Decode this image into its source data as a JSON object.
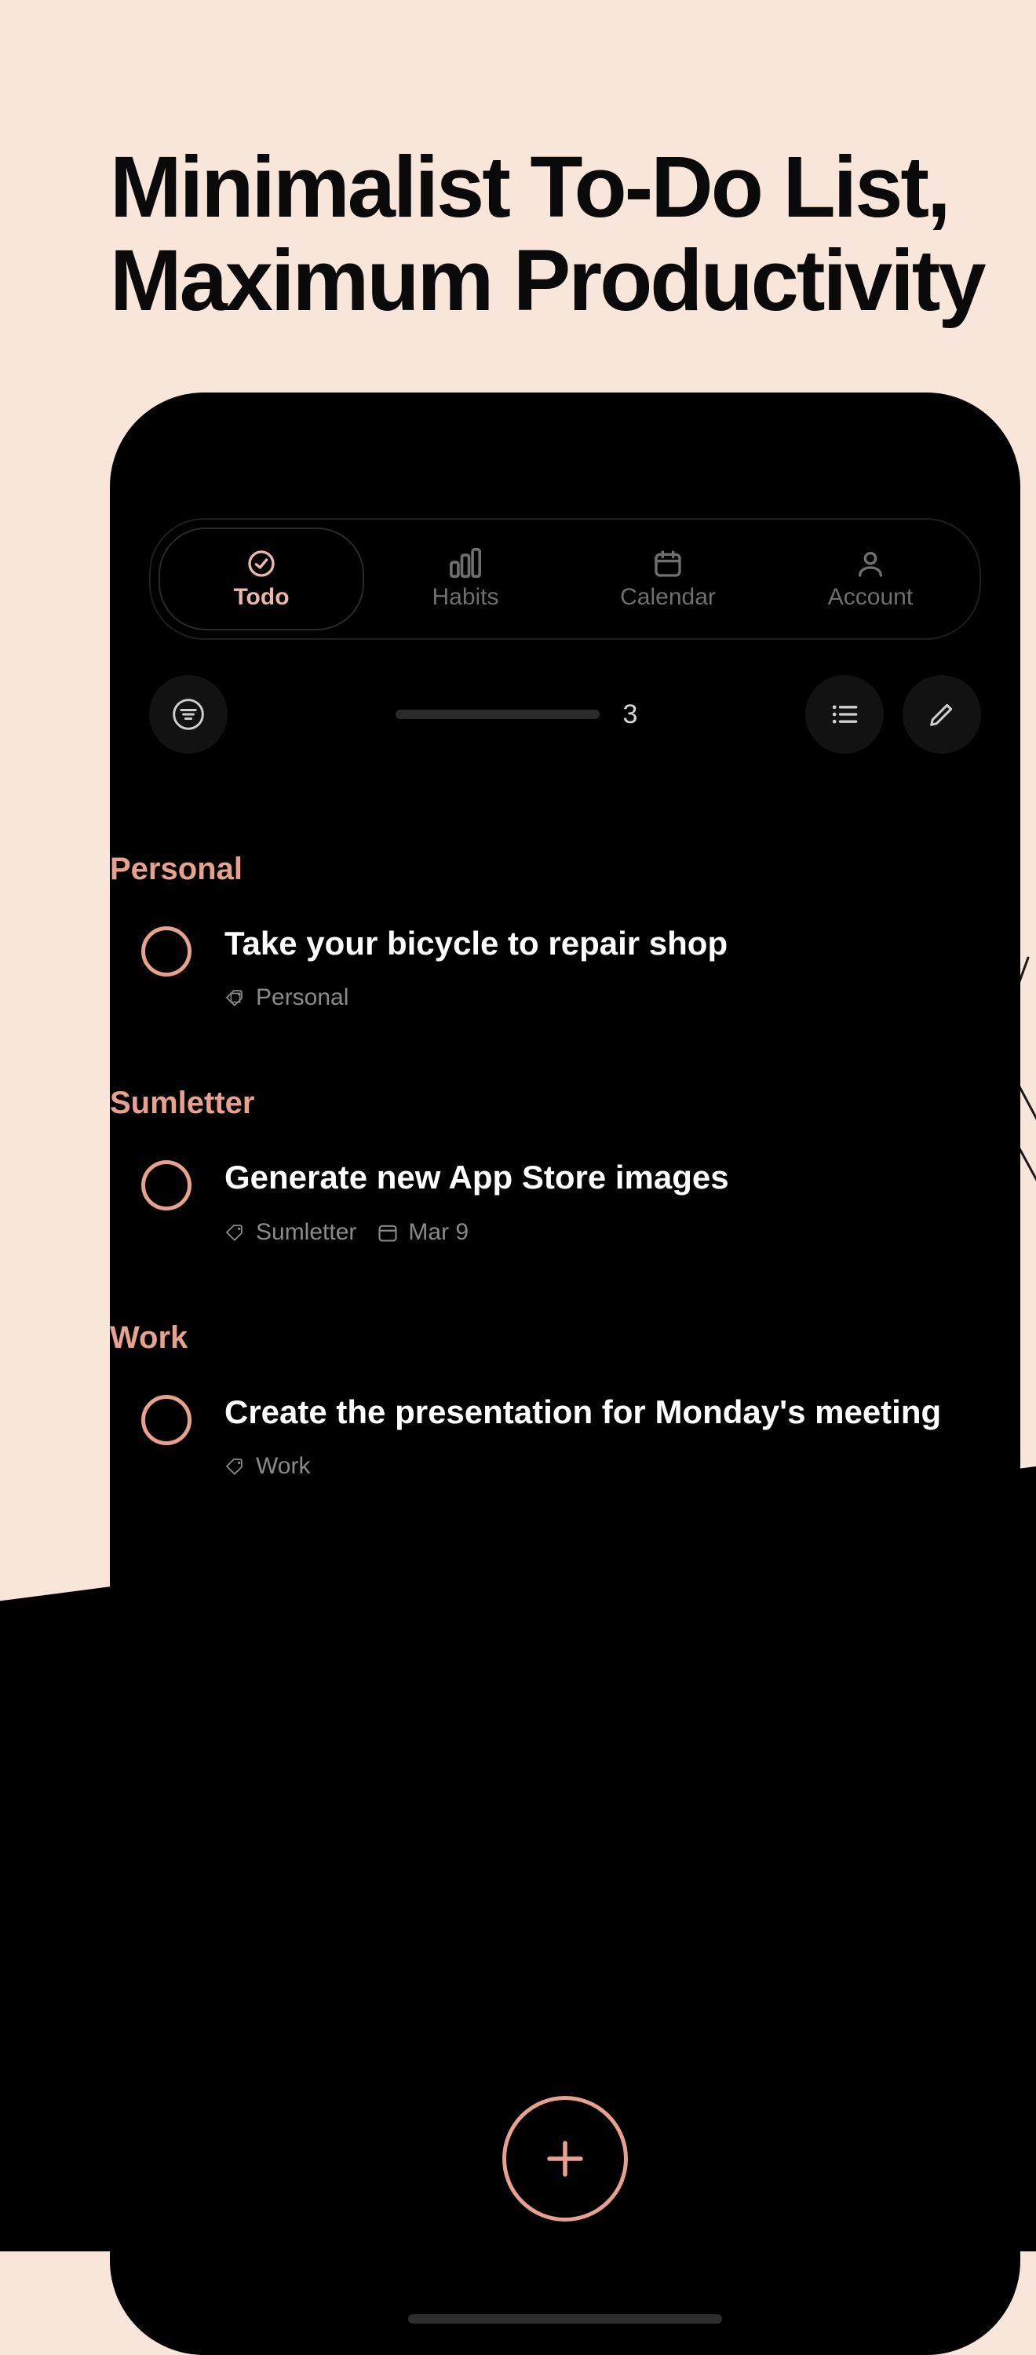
{
  "headline": {
    "line1": "Minimalist To-Do List,",
    "line2": "Maximum Productivity"
  },
  "nav": {
    "tabs": [
      {
        "label": "Todo",
        "icon": "check-circle-icon",
        "active": true
      },
      {
        "label": "Habits",
        "icon": "bar-chart-icon",
        "active": false
      },
      {
        "label": "Calendar",
        "icon": "calendar-icon",
        "active": false
      },
      {
        "label": "Account",
        "icon": "person-icon",
        "active": false
      }
    ]
  },
  "toolbar": {
    "count": "3"
  },
  "sections": [
    {
      "title": "Personal",
      "task": {
        "title": "Take your bicycle to repair shop",
        "tag": "Personal",
        "date": null
      }
    },
    {
      "title": "Sumletter",
      "task": {
        "title": "Generate new App Store images",
        "tag": "Sumletter",
        "date": "Mar 9"
      }
    },
    {
      "title": "Work",
      "task": {
        "title": "Create the presentation for Monday's meeting",
        "tag": "Work",
        "date": null
      }
    }
  ],
  "colors": {
    "accent": "#e7a18d",
    "bg": "#f9e6da"
  }
}
